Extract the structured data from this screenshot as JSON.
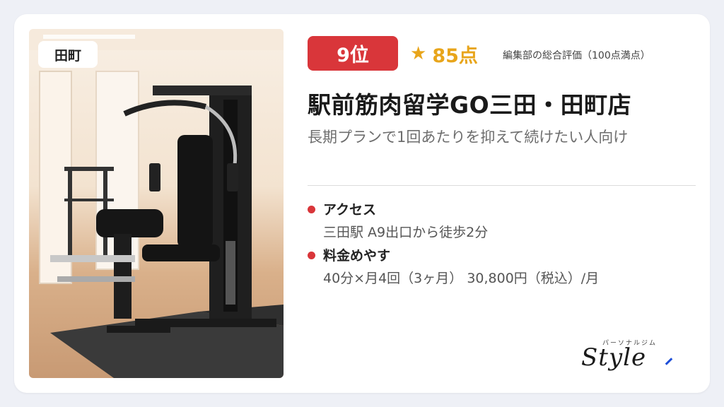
{
  "card": {
    "area_badge": "田町",
    "rank": "9位",
    "score": {
      "star": "★",
      "value": "85点",
      "note": "編集部の総合評価（100点満点）"
    },
    "title": "駅前筋肉留学GO三田・田町店",
    "subtitle": "長期プランで1回あたりを抑えて続けたい人向け",
    "access": {
      "label": "アクセス",
      "value": "三田駅 A9出口から徒歩2分"
    },
    "price": {
      "label": "料金めやす",
      "value": "40分×月4回（3ヶ月） 30,800円（税込）/月"
    },
    "logo": {
      "kana": "パーソナルジム",
      "word": "Style"
    }
  },
  "colors": {
    "accent_red": "#d9363a",
    "score_gold": "#e8a51b",
    "logo_blue": "#1f4fd8"
  },
  "icons": [
    "star-icon",
    "bullet-dot-icon"
  ]
}
